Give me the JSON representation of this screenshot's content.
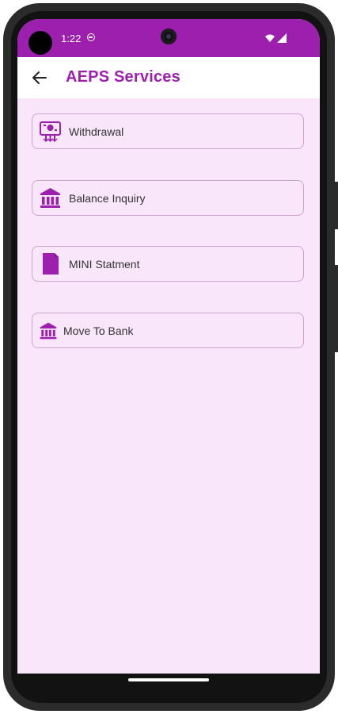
{
  "status_bar": {
    "time": "1:22",
    "color": "#9c1fae"
  },
  "app_bar": {
    "title": "AEPS Services",
    "back_icon": "arrow-back-icon",
    "title_color": "#9c1fae"
  },
  "services": [
    {
      "label": "Withdrawal",
      "icon": "withdrawal-icon"
    },
    {
      "label": "Balance Inquiry",
      "icon": "bank-icon"
    },
    {
      "label": "MINI Statment",
      "icon": "document-icon"
    },
    {
      "label": "Move To Bank",
      "icon": "bank-icon"
    }
  ],
  "theme": {
    "accent": "#9c1fae",
    "background": "#f9e6fa",
    "border": "#c9a5cc",
    "text": "#333333"
  }
}
